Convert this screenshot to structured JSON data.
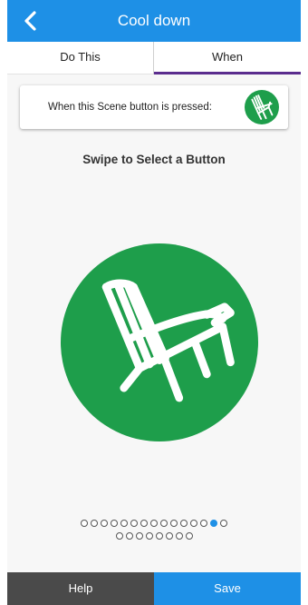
{
  "header": {
    "title": "Cool down",
    "back_icon": "chevron-left-icon"
  },
  "tabs": [
    {
      "label": "Do This",
      "selected": false
    },
    {
      "label": "When",
      "selected": true
    }
  ],
  "colors": {
    "header": "#1e90e6",
    "tab_indicator": "#5b2d8e",
    "icon_green": "#1e9e4b",
    "help_bg": "#4a4a4a",
    "save_bg": "#1e90e6"
  },
  "trigger_card": {
    "text": "When this Scene button is pressed:",
    "icon": "adirondack-chair-icon"
  },
  "selector": {
    "instruction": "Swipe to Select a Button",
    "selected_icon": "adirondack-chair-icon",
    "page_dots": {
      "row1_count": 15,
      "row2_count": 8,
      "active_index": 13
    }
  },
  "footer": {
    "help_label": "Help",
    "save_label": "Save"
  }
}
